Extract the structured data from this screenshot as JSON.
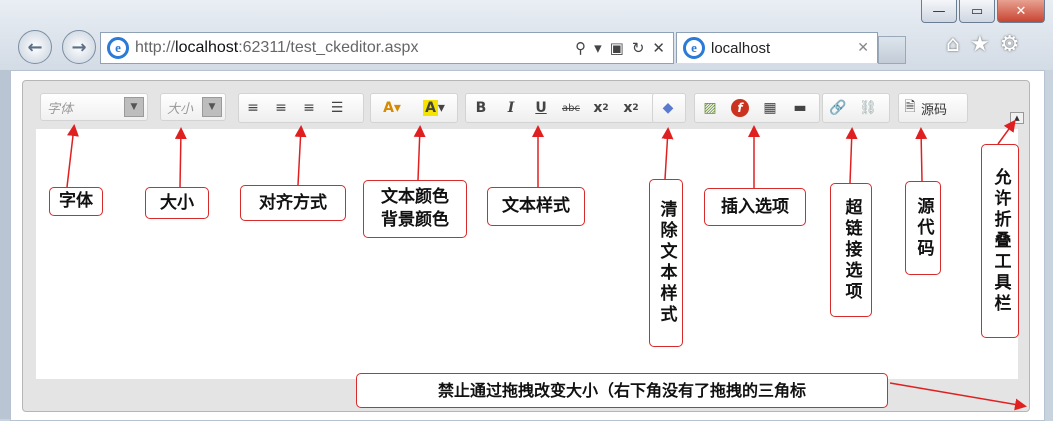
{
  "browser": {
    "url_prefix": "http://",
    "url_host": "localhost",
    "url_rest": ":62311/test_ckeditor.aspx",
    "tab_title": "localhost",
    "window_buttons": [
      "—",
      "▭",
      "✕"
    ]
  },
  "toolbar": {
    "font_combo": "字体",
    "size_combo": "大小",
    "source_label": "源码"
  },
  "annotations": {
    "font": "字体",
    "size": "大小",
    "align": "对齐方式",
    "color": "文本颜色\n背景颜色",
    "style": "文本样式",
    "remove_format": "清除文本样式",
    "insert": "插入选项",
    "link": "超链接选项",
    "source": "源代码",
    "collapse": "允许折叠工具栏",
    "resize": "禁止通过拖拽改变大小（右下角没有了拖拽的三角标"
  },
  "colors": {
    "annotation_border": "#d72a2a",
    "arrow": "#e02020",
    "ie_blue": "#2a7ad6"
  }
}
